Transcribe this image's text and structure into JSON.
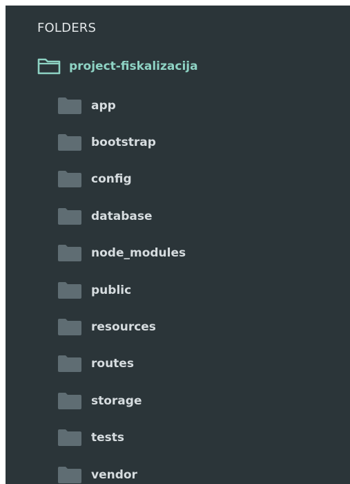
{
  "sidebar": {
    "header": "FOLDERS",
    "root": {
      "label": "project-fiskalizacija",
      "icon": "folder-open-icon"
    },
    "folders": [
      {
        "label": "app",
        "icon": "folder-icon"
      },
      {
        "label": "bootstrap",
        "icon": "folder-icon"
      },
      {
        "label": "config",
        "icon": "folder-icon"
      },
      {
        "label": "database",
        "icon": "folder-icon"
      },
      {
        "label": "node_modules",
        "icon": "folder-icon"
      },
      {
        "label": "public",
        "icon": "folder-icon"
      },
      {
        "label": "resources",
        "icon": "folder-icon"
      },
      {
        "label": "routes",
        "icon": "folder-icon"
      },
      {
        "label": "storage",
        "icon": "folder-icon"
      },
      {
        "label": "tests",
        "icon": "folder-icon"
      },
      {
        "label": "vendor",
        "icon": "folder-icon"
      }
    ],
    "colors": {
      "background": "#2b3539",
      "header_text": "#e2e6e8",
      "root_accent": "#8ed3c4",
      "folder_text": "#d6dcdf",
      "folder_icon": "#5f6d73"
    }
  }
}
